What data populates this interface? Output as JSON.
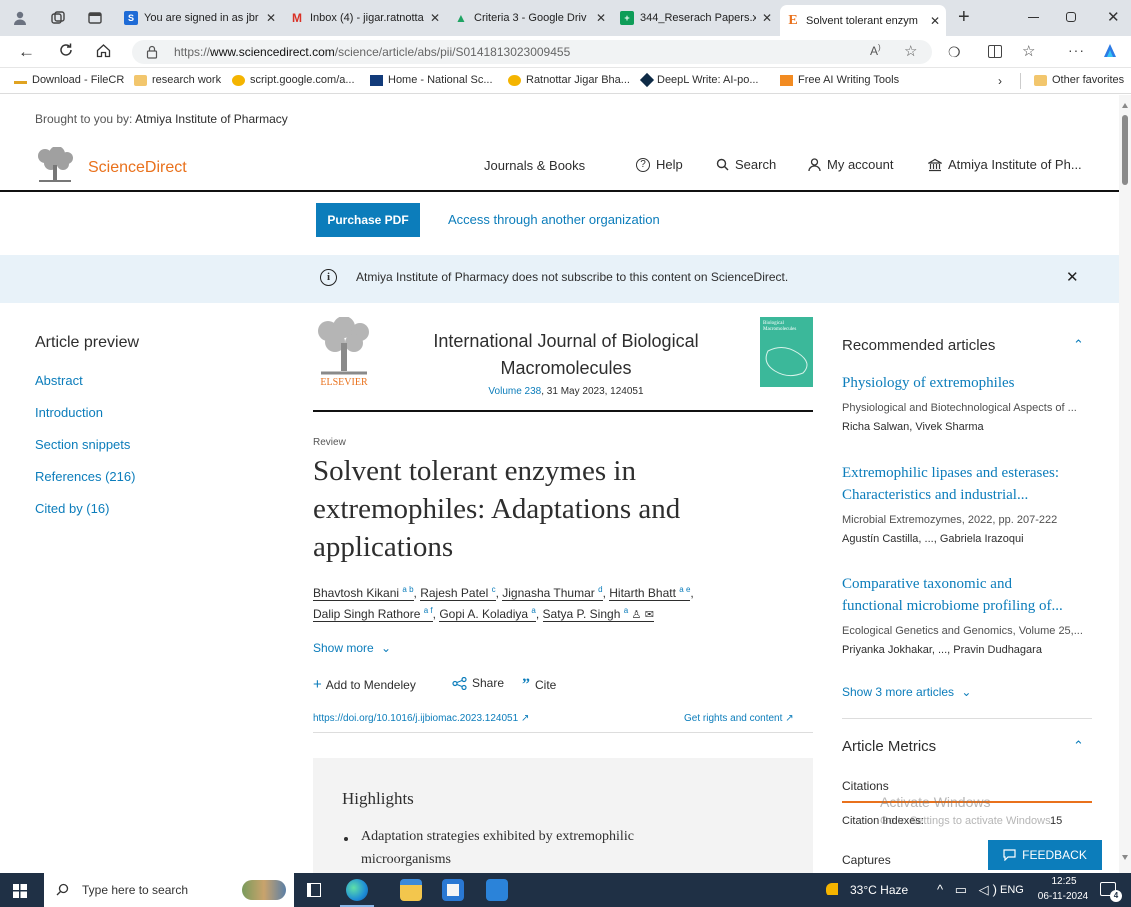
{
  "browser": {
    "tabs": [
      {
        "title": "You are signed in as jbr",
        "favicon": "S",
        "color": "#1e6bd6"
      },
      {
        "title": "Inbox (4) - jigar.ratnotta",
        "favicon": "M",
        "color": "#d93025"
      },
      {
        "title": "Criteria 3 - Google Driv",
        "favicon": "▲",
        "color": "#1fa463"
      },
      {
        "title": "344_Reserach Papers.xl",
        "favicon": "+",
        "color": "#0f9d58"
      },
      {
        "title": "Solvent tolerant enzym",
        "favicon": "E",
        "color": "#e9711c"
      }
    ],
    "url_prefix": "https://",
    "url_host": "www.sciencedirect.com",
    "url_path": "/science/article/abs/pii/S0141813023009455",
    "bookmarks": [
      "Download - FileCR",
      "research work",
      "script.google.com/a...",
      "Home - National Sc...",
      "Ratnottar Jigar Bha...",
      "DeepL Write: AI-po...",
      "Free AI Writing Tools"
    ],
    "other_favorites": "Other favorites"
  },
  "header": {
    "brought_by_label": "Brought to you by:",
    "brought_by_org": "Atmiya Institute of Pharmacy",
    "logo_text": "ScienceDirect",
    "nav": {
      "journals": "Journals & Books",
      "help": "Help",
      "search": "Search",
      "account": "My account",
      "institution": "Atmiya Institute of Ph..."
    }
  },
  "actions": {
    "purchase": "Purchase PDF",
    "access": "Access through another organization"
  },
  "banner": {
    "text": "Atmiya Institute of Pharmacy does not subscribe to this content on ScienceDirect."
  },
  "preview": {
    "heading": "Article preview",
    "links": [
      "Abstract",
      "Introduction",
      "Section snippets",
      "References (216)",
      "Cited by (16)"
    ]
  },
  "journal": {
    "publisher": "ELSEVIER",
    "name_line1": "International Journal of Biological",
    "name_line2": "Macromolecules",
    "volume": "Volume 238",
    "date": ", 31 May 2023, 124051",
    "cover_text": "Biological Macromolecules"
  },
  "article": {
    "type": "Review",
    "title_lines": [
      "Solvent tolerant enzymes in",
      "extremophiles: Adaptations and",
      "applications"
    ],
    "authors_line1": [
      {
        "name": "Bhavtosh Kikani",
        "sup": "a b"
      },
      {
        "name": "Rajesh Patel",
        "sup": "c"
      },
      {
        "name": "Jignasha Thumar",
        "sup": "d"
      },
      {
        "name": "Hitarth Bhatt",
        "sup": "a e"
      }
    ],
    "authors_line2": [
      {
        "name": "Dalip Singh Rathore",
        "sup": "a f"
      },
      {
        "name": "Gopi A. Koladiya",
        "sup": "a"
      },
      {
        "name": "Satya P. Singh",
        "sup": "a"
      }
    ],
    "show_more": "Show more",
    "add_mendeley": "Add to Mendeley",
    "share": "Share",
    "cite": "Cite",
    "doi": "https://doi.org/10.1016/j.ijbiomac.2023.124051",
    "rights": "Get rights and content"
  },
  "highlights": {
    "heading": "Highlights",
    "item1_line1": "Adaptation strategies exhibited by extremophilic",
    "item1_line2": "microorganisms"
  },
  "recommended": {
    "heading": "Recommended articles",
    "items": [
      {
        "title1": "Physiology of extremophiles",
        "title2": "",
        "meta": "Physiological and Biotechnological Aspects of ...",
        "authors": "Richa Salwan, Vivek Sharma"
      },
      {
        "title1": "Extremophilic lipases and esterases:",
        "title2": "Characteristics and industrial...",
        "meta": "Microbial Extremozymes, 2022, pp. 207-222",
        "authors": "Agustín Castilla, ..., Gabriela Irazoqui"
      },
      {
        "title1": "Comparative taxonomic and",
        "title2": "functional microbiome profiling of...",
        "meta": "Ecological Genetics and Genomics, Volume 25,...",
        "authors": "Priyanka Jokhakar, ..., Pravin Dudhagara"
      }
    ],
    "show_more": "Show 3 more articles"
  },
  "metrics": {
    "heading": "Article Metrics",
    "citations": "Citations",
    "citation_indexes": "Citation Indexes:",
    "citation_count": "15",
    "captures": "Captures"
  },
  "watermark": {
    "line1": "Activate Windows",
    "line2": "Go to Settings to activate Windows."
  },
  "feedback": "FEEDBACK",
  "taskbar": {
    "search_placeholder": "Type here to search",
    "weather": "33°C  Haze",
    "lang": "ENG",
    "time": "12:25",
    "date": "06-11-2024",
    "notifications": "4"
  }
}
